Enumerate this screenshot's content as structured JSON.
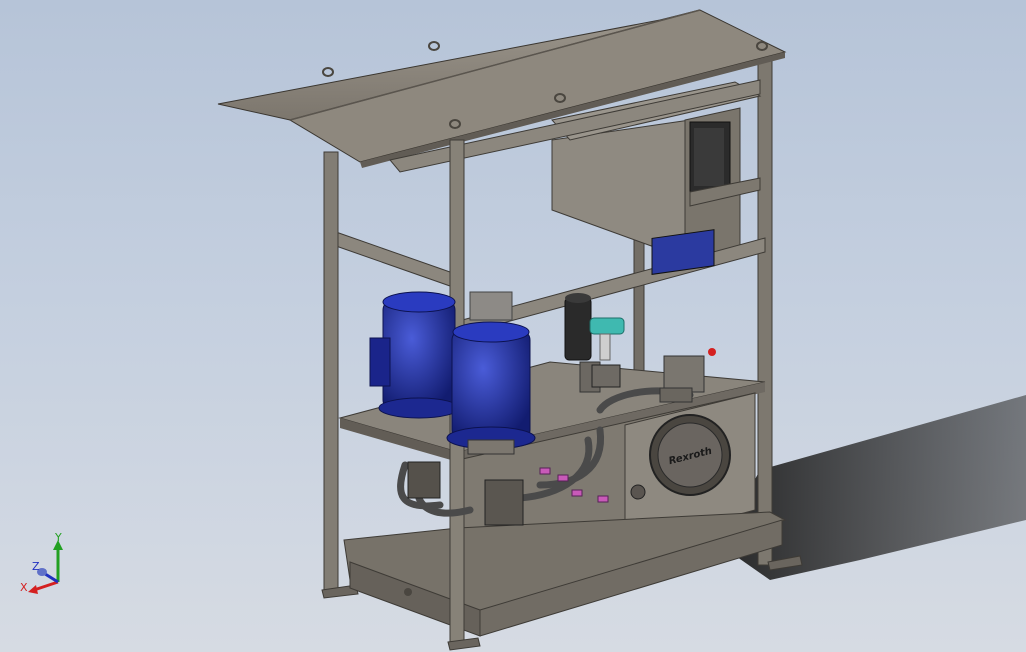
{
  "model": {
    "description_hidden": false,
    "logo_text": "Rexroth"
  },
  "triad": {
    "x_label": "X",
    "y_label": "Y",
    "z_label": "Z",
    "colors": {
      "x": "#d42020",
      "y": "#22a022",
      "z": "#2030c0"
    }
  },
  "colors": {
    "steel": "#8a857d",
    "steel_dark": "#5e5a53",
    "steel_light": "#a8a39a",
    "motor_blue": "#1f2fa8",
    "valve_blue": "#2b3aa0",
    "shadow": "#2a2a2a"
  }
}
